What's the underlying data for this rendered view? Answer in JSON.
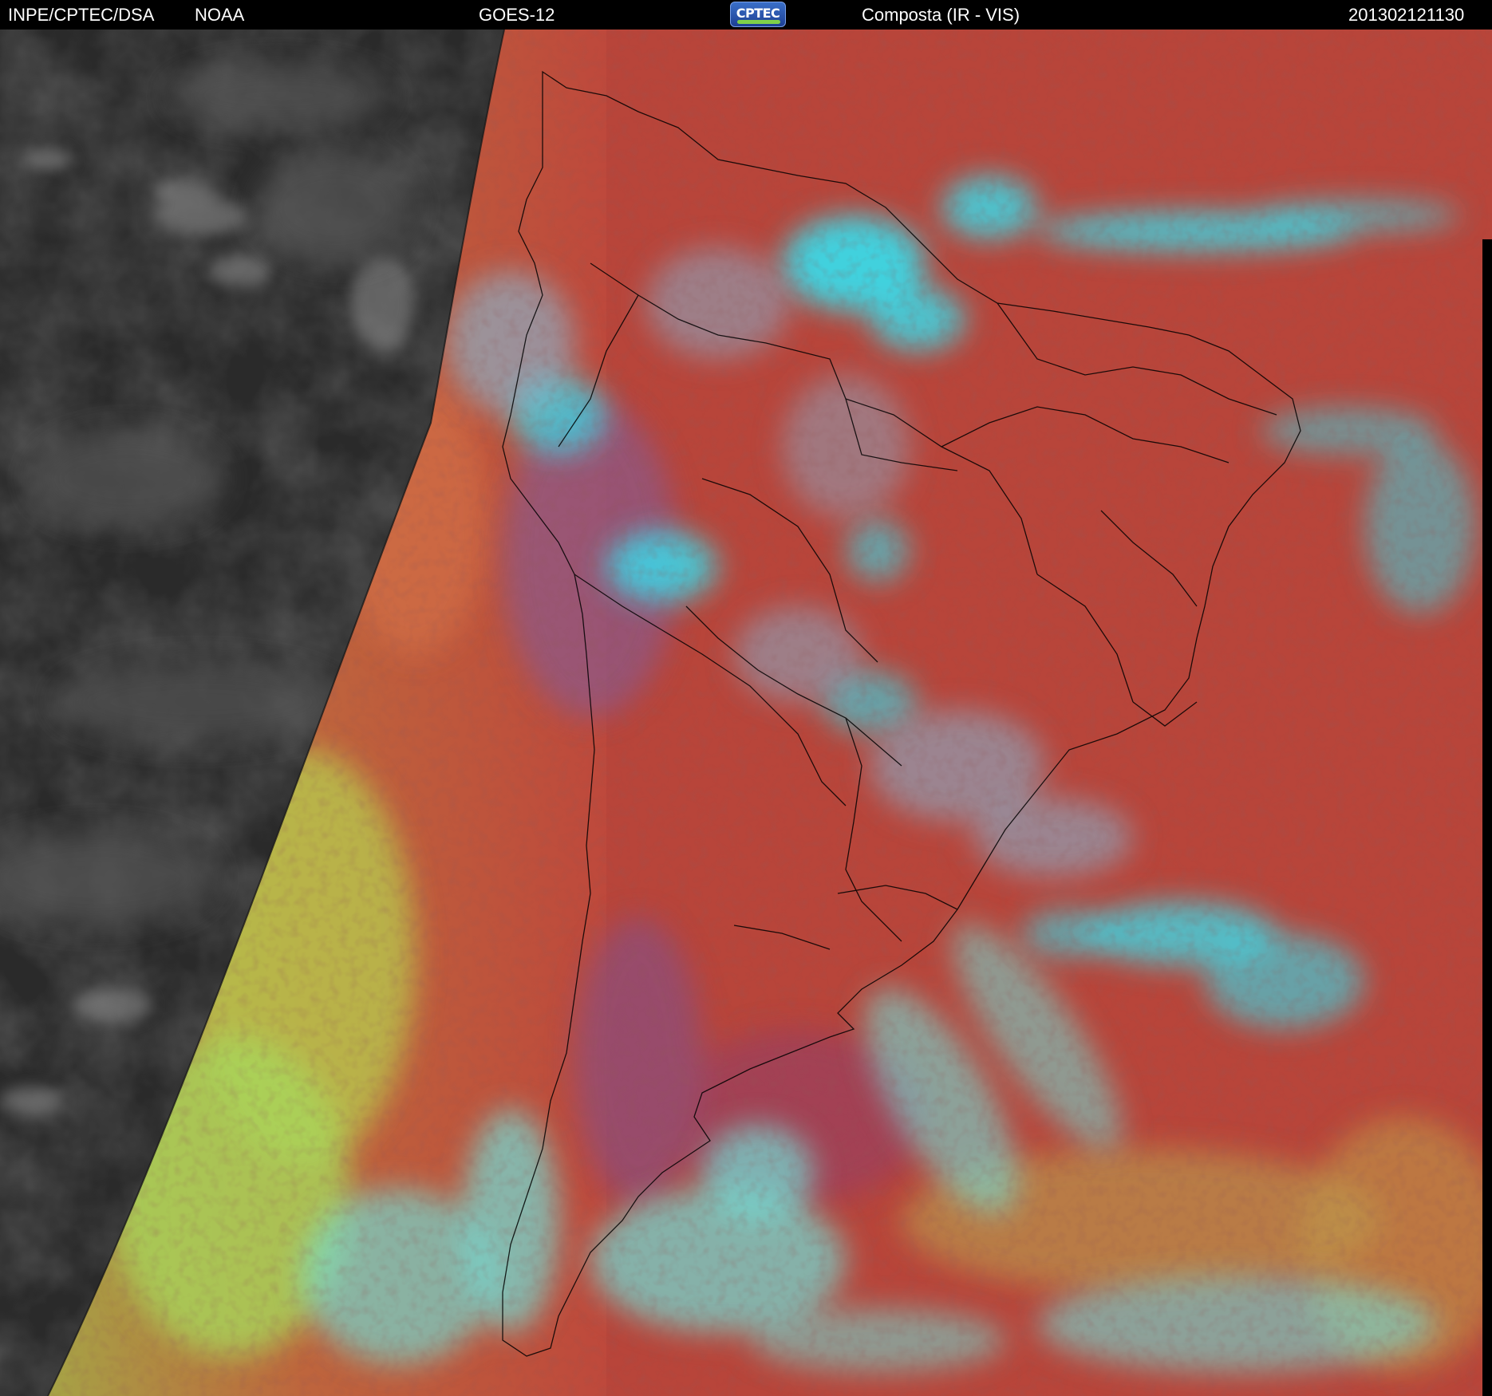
{
  "header": {
    "source": "INPE/CPTEC/DSA",
    "agency": "NOAA",
    "satellite": "GOES-12",
    "product": "Composta (IR - VIS)",
    "timestamp": "201302121130",
    "logo_text": "CPTEC"
  },
  "icons": {
    "logo": "cptec-logo-icon"
  },
  "colors": {
    "ir_background": "#2c2c2c",
    "land_red": "#b8453a",
    "cloud_cyan": "#34e0f0",
    "cloud_green": "#9ad65a",
    "border_lines": "#000000"
  }
}
